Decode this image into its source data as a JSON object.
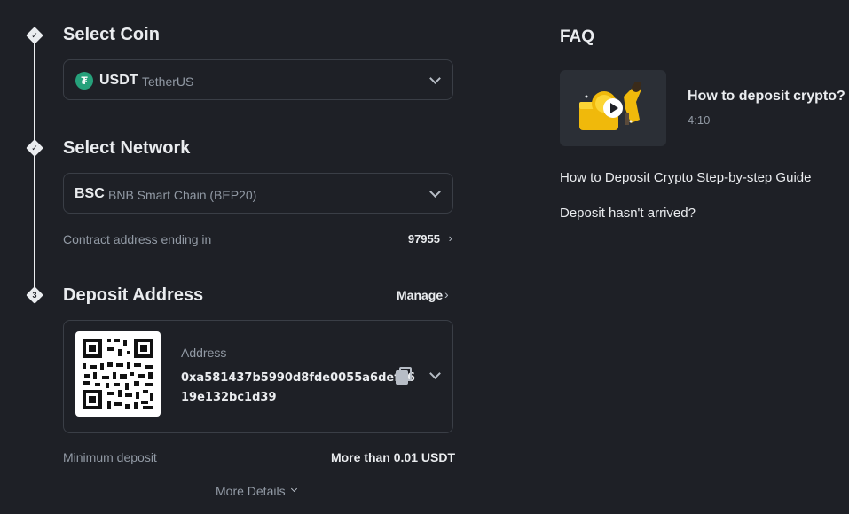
{
  "steps": {
    "select_coin": {
      "title": "Select Coin",
      "coin_symbol": "USDT",
      "coin_name": "TetherUS"
    },
    "select_network": {
      "title": "Select Network",
      "network_code": "BSC",
      "network_name": "BNB Smart Chain (BEP20)",
      "contract_label": "Contract address ending in",
      "contract_value": "97955"
    },
    "deposit_address": {
      "step_number": "3",
      "title": "Deposit Address",
      "manage_label": "Manage",
      "address_label": "Address",
      "address_line1": "0xa581437b5990d8fde0055a6def76",
      "address_line2": "19e132bc1d39",
      "min_deposit_label": "Minimum deposit",
      "min_deposit_value": "More than 0.01 USDT",
      "more_details_label": "More Details"
    }
  },
  "faq": {
    "title": "FAQ",
    "video": {
      "title": "How to deposit crypto?",
      "duration": "4:10"
    },
    "links": [
      "How to Deposit Crypto Step-by-step Guide",
      "Deposit hasn't arrived?"
    ]
  },
  "colors": {
    "background": "#1e2026",
    "text": "#eaecef",
    "muted": "#929aa5",
    "border": "#3a3e46",
    "tether": "#26a17b",
    "accent": "#f0b90b"
  },
  "icons": [
    "check-icon",
    "chevron-down-icon",
    "chevron-right-icon",
    "copy-icon",
    "qr-code",
    "play-icon",
    "tether-icon"
  ]
}
